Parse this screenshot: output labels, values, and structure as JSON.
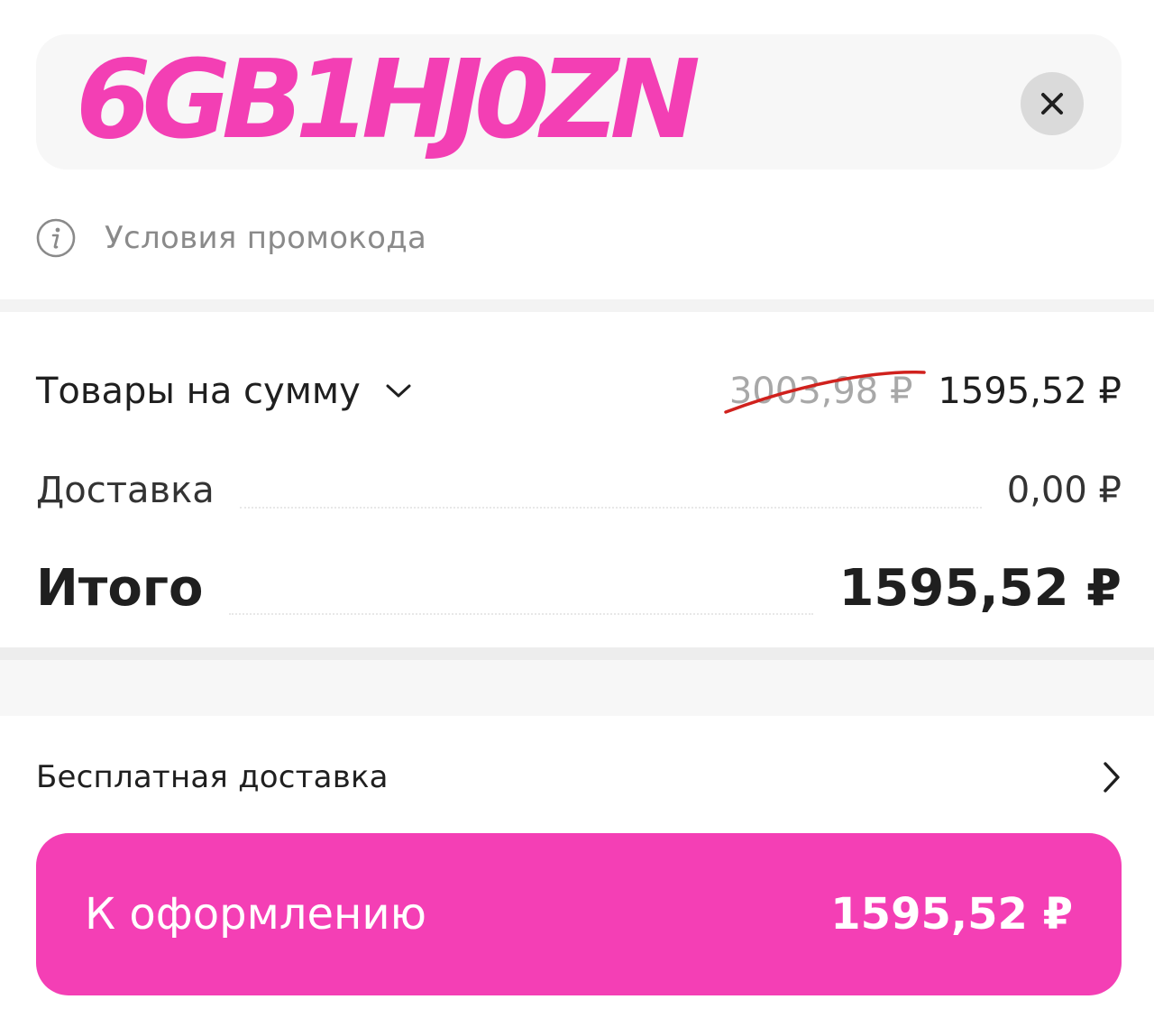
{
  "promo": {
    "code": "6GB1HJ0ZN",
    "code_color": "#f33fb4",
    "clear_icon": "close-icon"
  },
  "terms": {
    "icon": "info-icon",
    "label": "Условия промокода"
  },
  "summary": {
    "goods_label": "Товары на сумму",
    "goods_old_price": "3003,98 ₽",
    "goods_new_price": "1595,52 ₽",
    "delivery_label": "Доставка",
    "delivery_value": "0,00 ₽",
    "total_label": "Итого",
    "total_value": "1595,52 ₽"
  },
  "free_delivery": {
    "label": "Бесплатная доставка",
    "icon": "chevron-right-icon"
  },
  "checkout": {
    "label": "К оформлению",
    "price": "1595,52 ₽",
    "color": "#f43fb5"
  }
}
